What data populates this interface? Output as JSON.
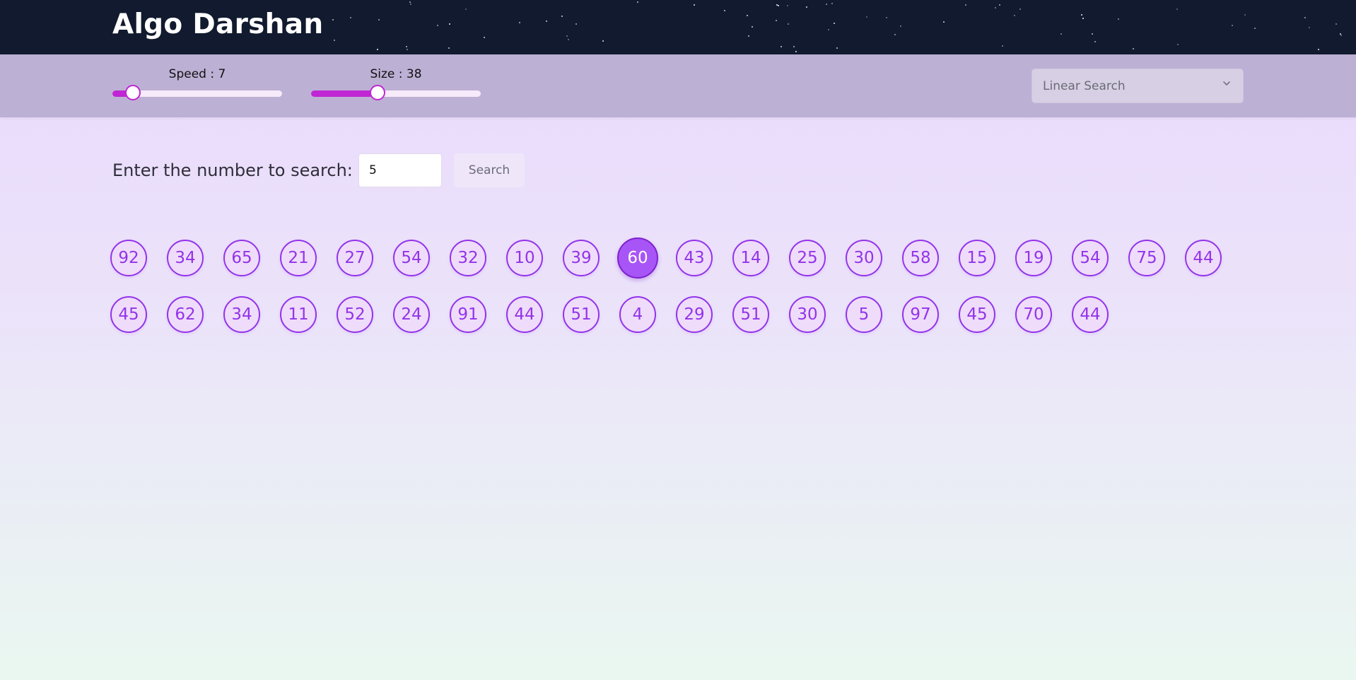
{
  "app": {
    "title": "Algo Darshan"
  },
  "controls": {
    "speed": {
      "label": "Speed : 7",
      "value": 7,
      "fill_fraction": 0.12
    },
    "size": {
      "label": "Size : 38",
      "value": 38,
      "fill_fraction": 0.39
    },
    "algorithm_select": {
      "value": "Linear Search"
    }
  },
  "search": {
    "prompt": "Enter the number to search:",
    "input_value": "5",
    "button_label": "Search"
  },
  "array": {
    "values": [
      92,
      34,
      65,
      21,
      27,
      54,
      32,
      10,
      39,
      60,
      43,
      14,
      25,
      30,
      58,
      15,
      19,
      54,
      75,
      44,
      45,
      62,
      34,
      11,
      52,
      24,
      91,
      44,
      51,
      4,
      29,
      51,
      30,
      5,
      97,
      45,
      70,
      44
    ],
    "active_index": 9
  },
  "colors": {
    "accent": "#c026d3",
    "circle_border": "#9333ea",
    "circle_active": "#a855f7",
    "header_bg": "#111a2e"
  },
  "icons": {
    "select": "chevron-down-icon"
  }
}
